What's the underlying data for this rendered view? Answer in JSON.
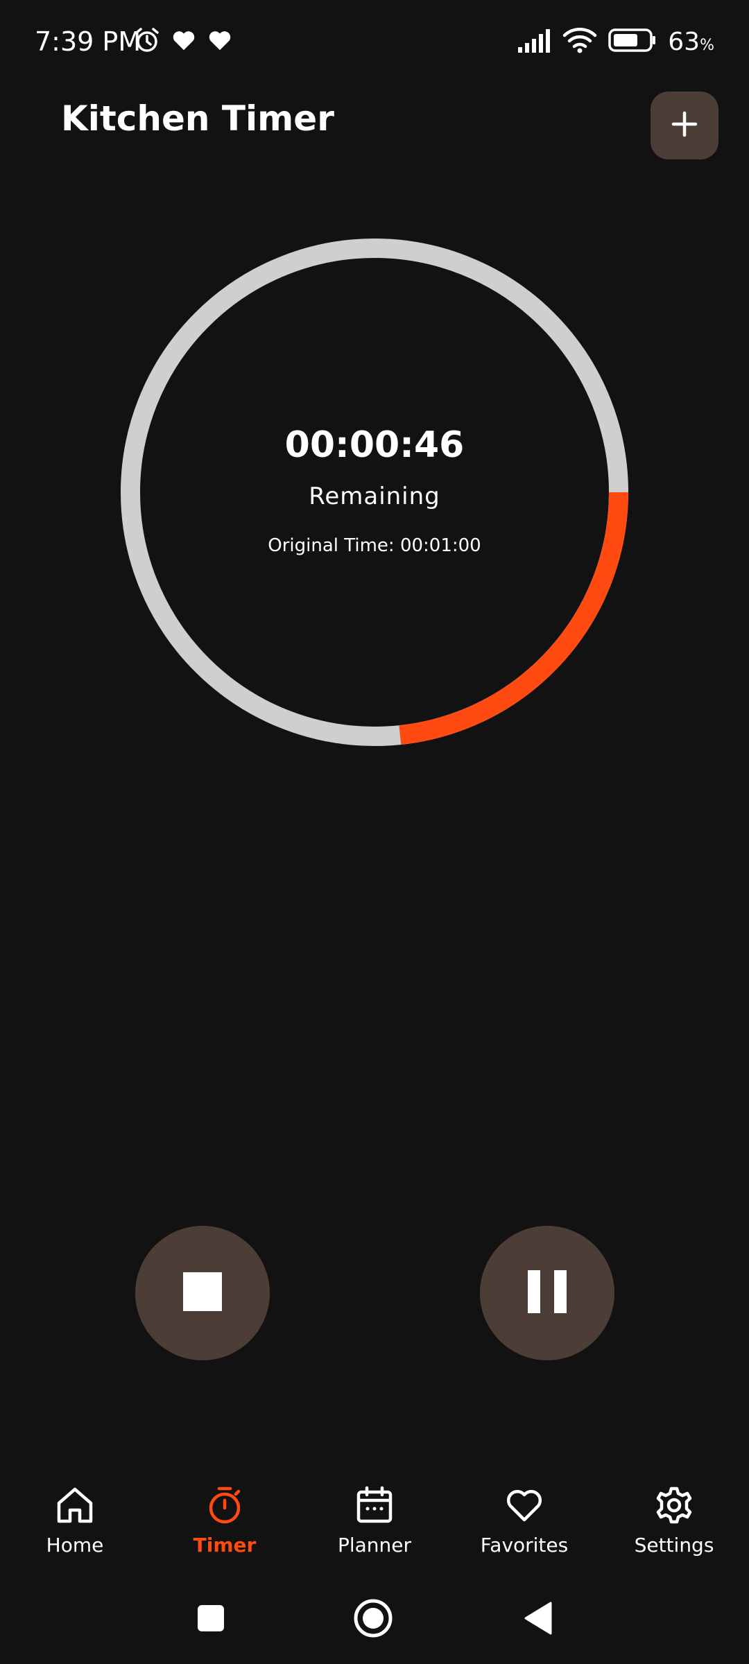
{
  "status_bar": {
    "time": "7:39 PM",
    "battery_percent": "63",
    "battery_unit": "%",
    "icons": [
      "alarm-icon",
      "heart-icon",
      "heart-icon",
      "signal-icon",
      "wifi-icon",
      "battery-icon"
    ]
  },
  "header": {
    "title": "Kitchen Timer",
    "add_icon": "plus-icon"
  },
  "timer": {
    "remaining": "00:00:46",
    "remaining_label": "Remaining",
    "original_time_text": "Original Time: 00:01:00",
    "remaining_seconds": 46,
    "total_seconds": 60,
    "ring_track_color": "#cfcfcf",
    "ring_progress_color": "#ff4a12"
  },
  "controls": {
    "stop_icon": "stop-icon",
    "pause_icon": "pause-icon",
    "button_color": "#4d3d37"
  },
  "bottom_nav": {
    "items": [
      {
        "label": "Home",
        "icon": "home-icon",
        "active": false
      },
      {
        "label": "Timer",
        "icon": "stopwatch-icon",
        "active": true
      },
      {
        "label": "Planner",
        "icon": "calendar-icon",
        "active": false
      },
      {
        "label": "Favorites",
        "icon": "heart-icon",
        "active": false
      },
      {
        "label": "Settings",
        "icon": "gear-icon",
        "active": false
      }
    ],
    "active_color": "#ff4a12"
  },
  "system_nav": {
    "icons": [
      "recents-square-icon",
      "home-circle-icon",
      "back-triangle-icon"
    ]
  }
}
